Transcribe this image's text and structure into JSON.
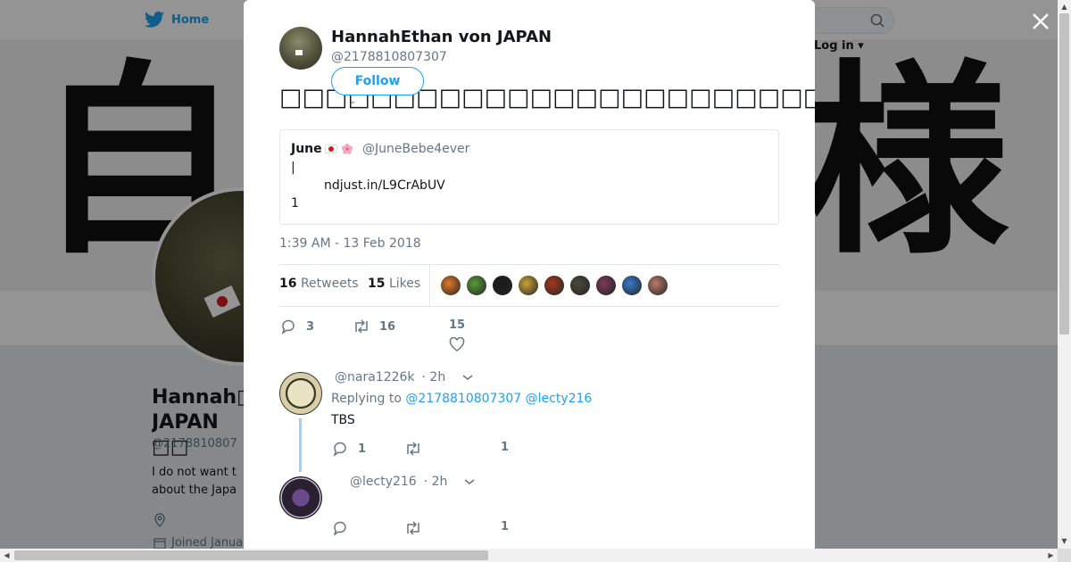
{
  "nav": {
    "home_label": "Home",
    "login_label": "Log in"
  },
  "background_profile": {
    "name": "Hannah□ JAPAN □□",
    "handle": "@2178810807",
    "bio": "I do not want t about the Japa",
    "joined": "Joined Janua"
  },
  "tweet": {
    "author_name": "HannahEthan von JAPAN",
    "author_handle": "@2178810807307",
    "follow_label": "Follow",
    "text": "□□□□□□□□□□□□□□□□□□□□□□□□□□□□□□□□□",
    "quote": {
      "name": "June",
      "handle": "@JuneBebe4ever",
      "line1": "|",
      "line2": "ndjust.in/L9CrAbUV",
      "line3": "1"
    },
    "timestamp": "1:39 AM - 13 Feb 2018",
    "retweets_count": "16",
    "retweets_label": "Retweets",
    "likes_count": "15",
    "likes_label": "Likes",
    "liker_colors": [
      "#e07b2a",
      "#5a9a3a",
      "#1a1a1a",
      "#c9a23a",
      "#a33a1e",
      "#4a4a3a",
      "#7a3a5a",
      "#3a7ac9",
      "#b87a6a"
    ],
    "action_replies": "3",
    "action_retweets": "16",
    "action_likes": "15"
  },
  "replies": [
    {
      "handle": "@nara1226k",
      "time": "· 2h",
      "replying_label": "Replying to",
      "replying_to": "@2178810807307 @lecty216",
      "text": "TBS",
      "reply_count": "1",
      "like_count": "1"
    },
    {
      "handle": "@lecty216",
      "time": "· 2h",
      "like_count": "1"
    }
  ],
  "colors": {
    "accent": "#1da1f2",
    "muted": "#657786",
    "text": "#14171a"
  }
}
